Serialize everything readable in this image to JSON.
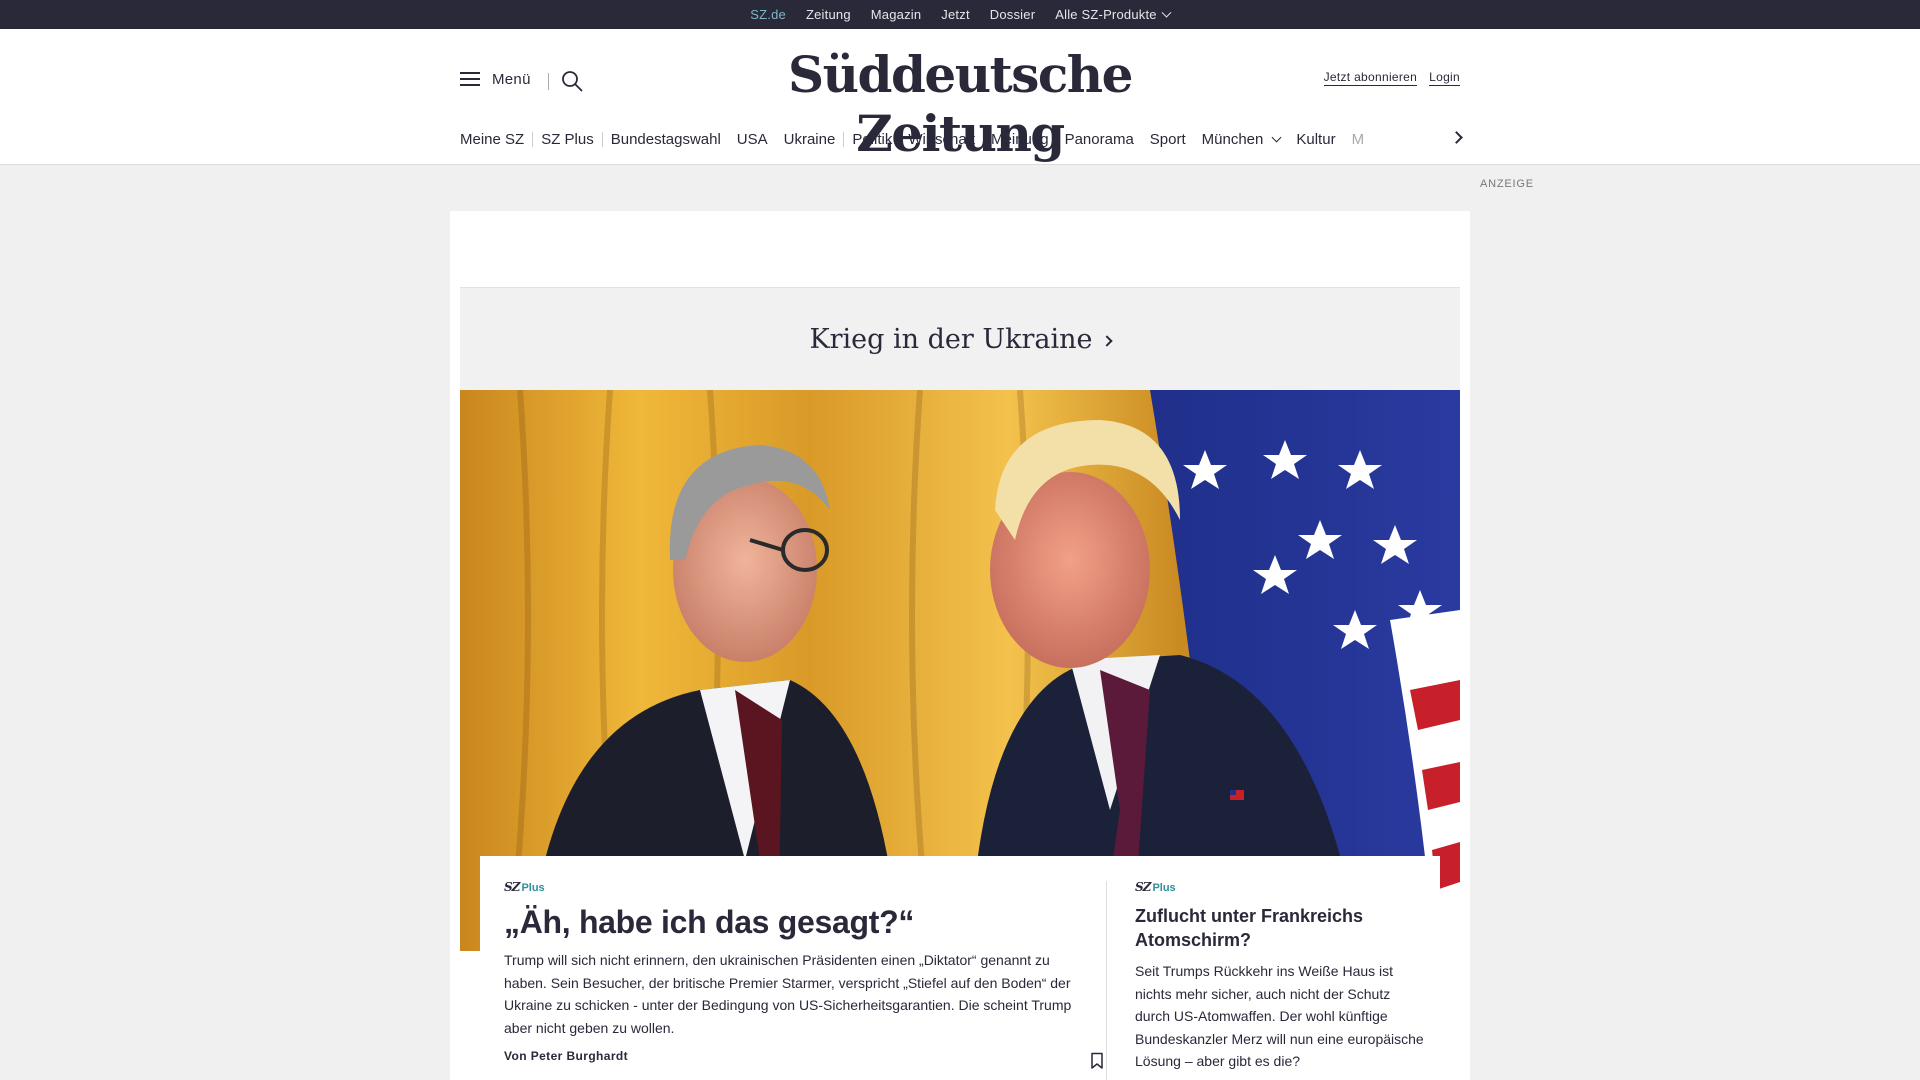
{
  "topbar": {
    "links": [
      "SZ.de",
      "Zeitung",
      "Magazin",
      "Jetzt",
      "Dossier",
      "Alle SZ-Produkte"
    ]
  },
  "header": {
    "menu_label": "Menü",
    "logo": "Süddeutsche Zeitung",
    "subscribe": "Jetzt abonnieren",
    "login": "Login"
  },
  "nav": {
    "items": [
      "Meine SZ",
      "SZ Plus",
      "Bundestagswahl",
      "USA",
      "Ukraine",
      "Politik",
      "Wirtschaft",
      "Meinung",
      "Panorama",
      "Sport",
      "München",
      "Kultur",
      "M"
    ]
  },
  "ad_label": "ANZEIGE",
  "section": {
    "title": "Krieg in der Ukraine"
  },
  "teaser_main": {
    "badge_sz": "SZ",
    "badge_plus": "Plus",
    "headline": "„Äh, habe ich das gesagt?“",
    "text": "Trump will sich nicht erinnern, den ukrainischen Präsidenten einen „Diktator“ genannt zu haben. Sein Besucher, der britische Premier Starmer, verspricht „Stiefel auf den Boden“ der Ukraine zu schicken - unter der Bedingung von US-Sicherheitsgarantien. Die scheint Trump aber nicht geben zu wollen.",
    "author": "Von Peter Burghardt"
  },
  "teaser_side": {
    "badge_sz": "SZ",
    "badge_plus": "Plus",
    "headline": "Zuflucht unter Frankreichs Atomschirm?",
    "text": "Seit Trumps Rückkehr ins Weiße Haus ist nichts mehr sicher, auch nicht der Schutz durch US-Atomwaffen. Der wohl künftige Bundeskanzler Merz will nun eine europäische Lösung – aber gibt es die?"
  },
  "colors": {
    "topbar_bg": "#29293a",
    "topbar_active": "#7fb6c6",
    "plus_accent": "#2f8f9a",
    "text": "#29293a"
  }
}
